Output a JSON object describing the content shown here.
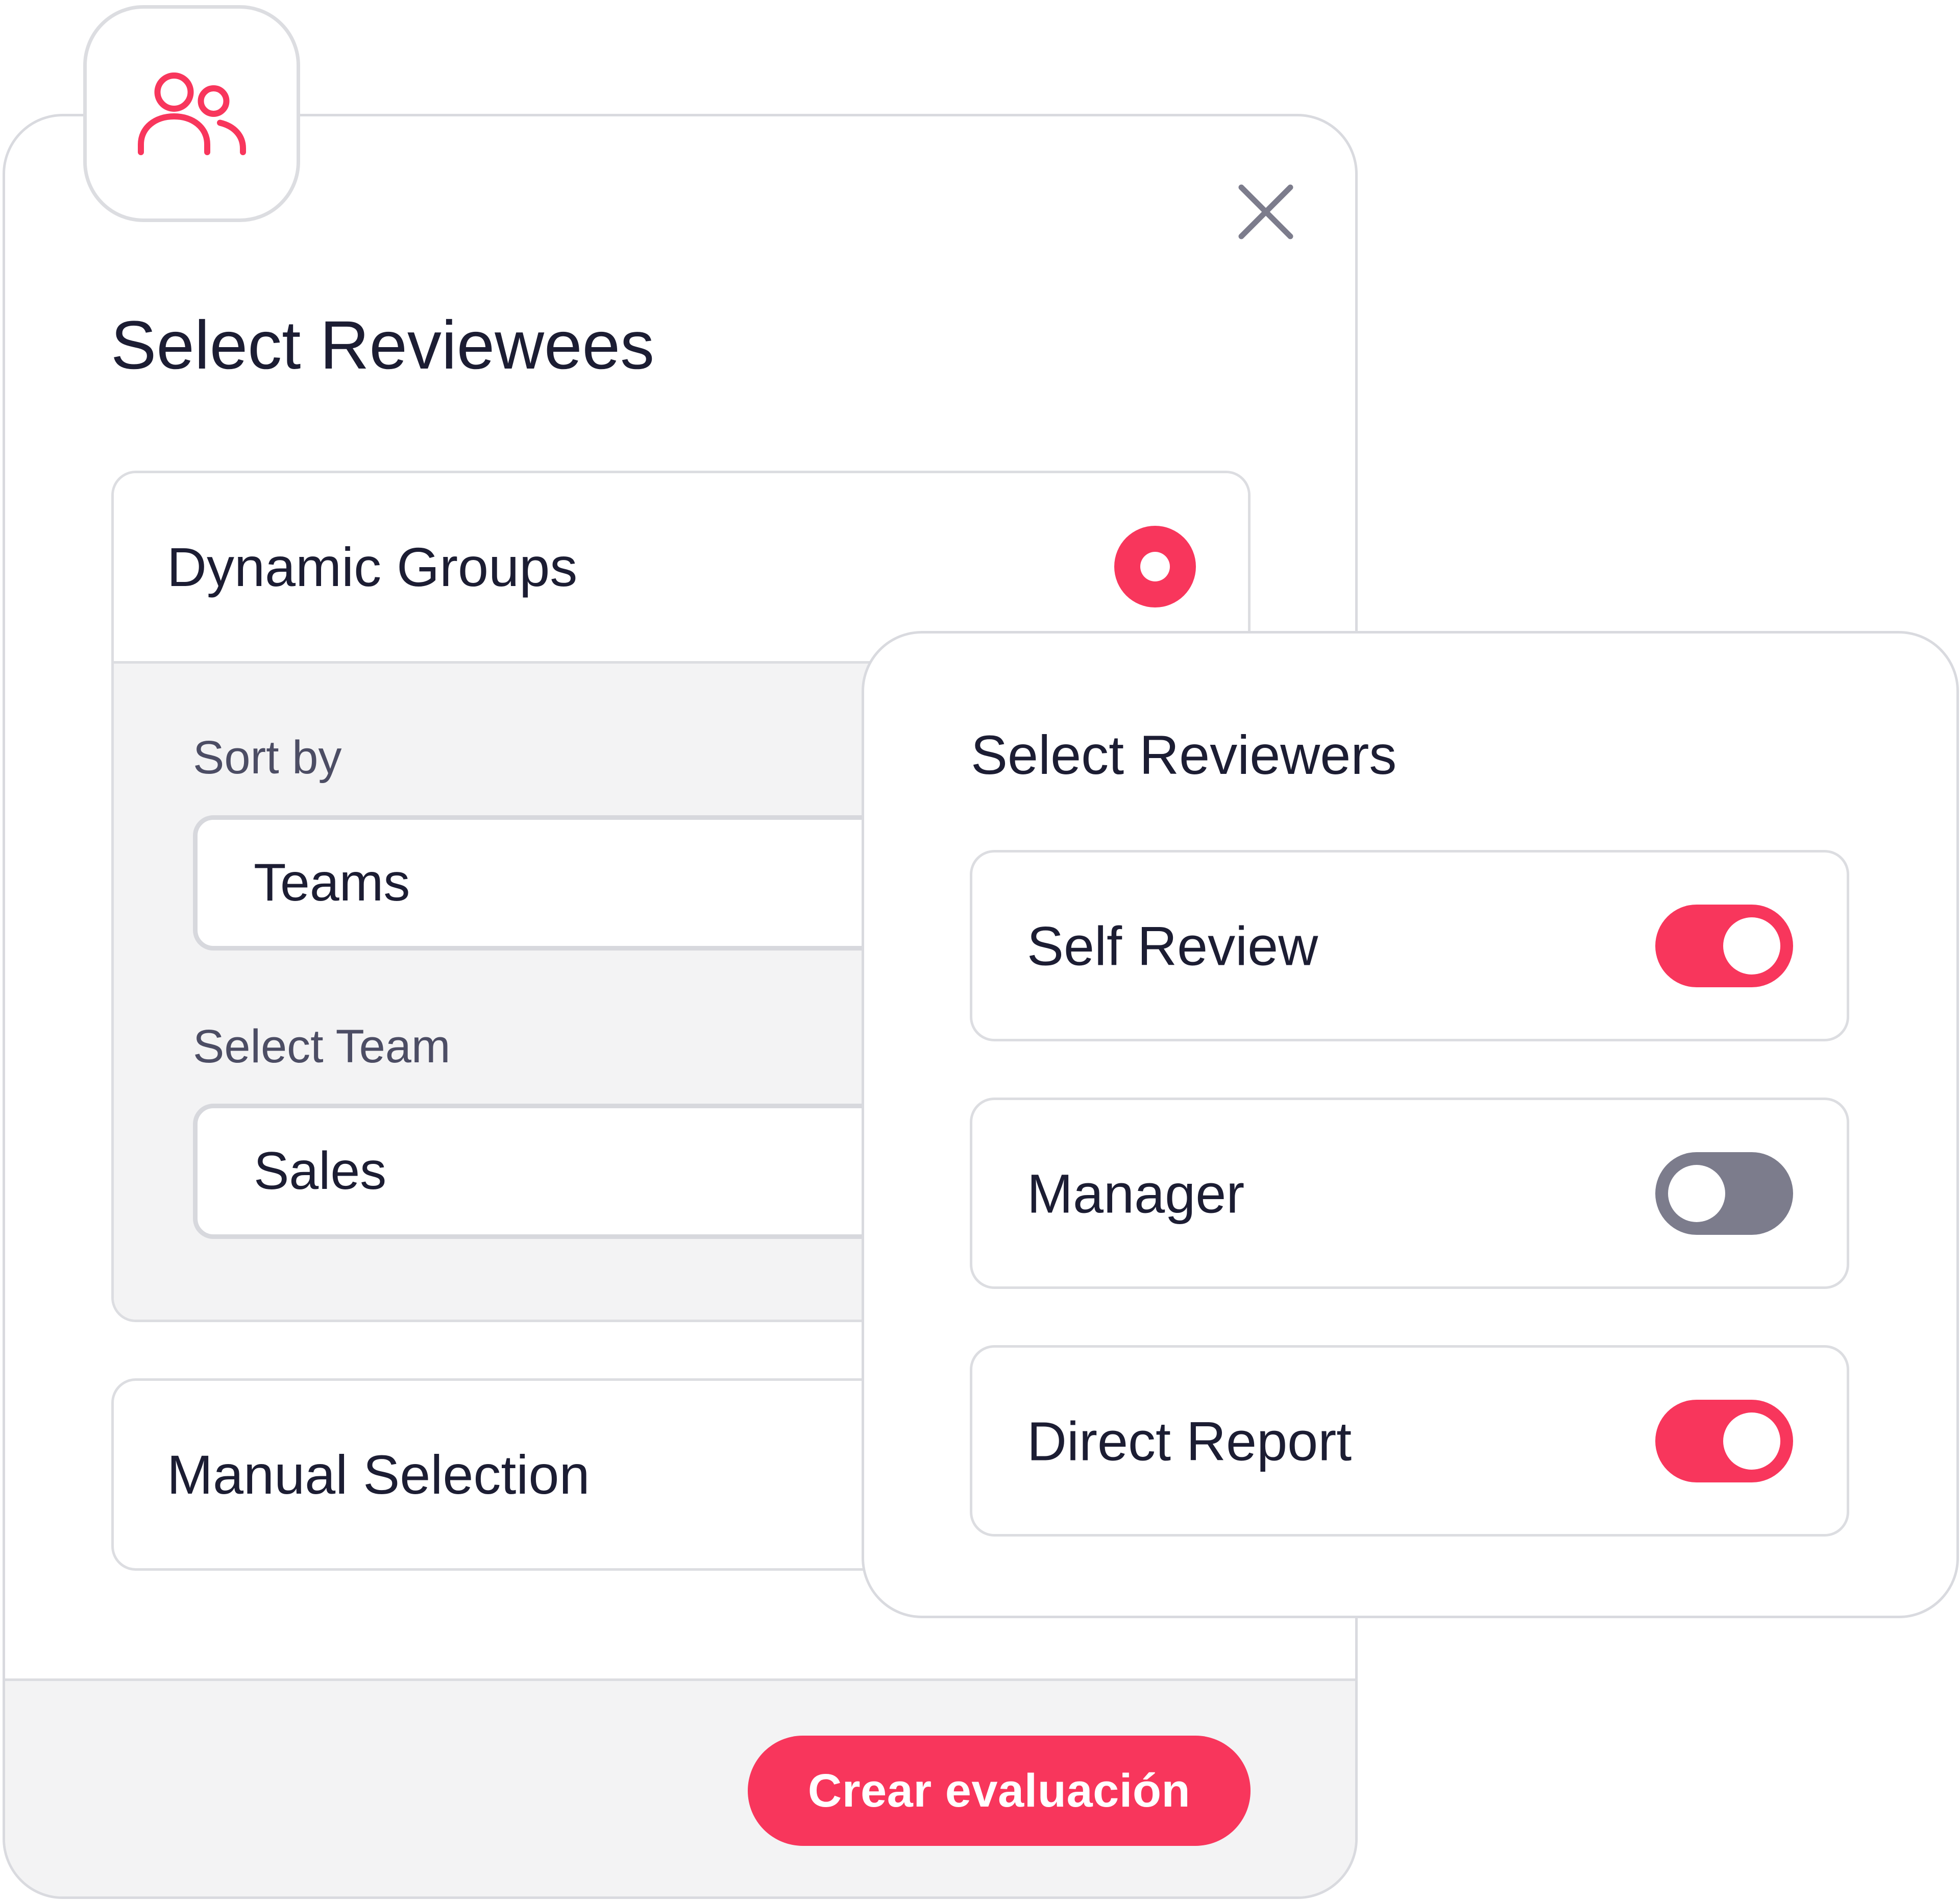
{
  "modal": {
    "title": "Select Reviewees",
    "primary_button_label": "Crear evaluación"
  },
  "dynamic_groups": {
    "title": "Dynamic Groups",
    "selected": true,
    "sort_by": {
      "label": "Sort by",
      "value": "Teams"
    },
    "select_team": {
      "label": "Select Team",
      "value": "Sales"
    }
  },
  "manual_selection": {
    "title": "Manual Selection",
    "selected": false
  },
  "reviewers": {
    "title": "Select Reviewers",
    "items": [
      {
        "label": "Self Review",
        "enabled": true
      },
      {
        "label": "Manager",
        "enabled": false
      },
      {
        "label": "Direct Report",
        "enabled": true
      }
    ]
  },
  "icons": {
    "header": "users-icon",
    "close": "close-icon"
  },
  "colors": {
    "accent": "#f8365c",
    "toggle_off": "#7c7c8c",
    "text": "#1c1d33",
    "muted_text": "#4c4d64",
    "border": "#dcdde1",
    "panel_bg": "#f3f3f4"
  }
}
